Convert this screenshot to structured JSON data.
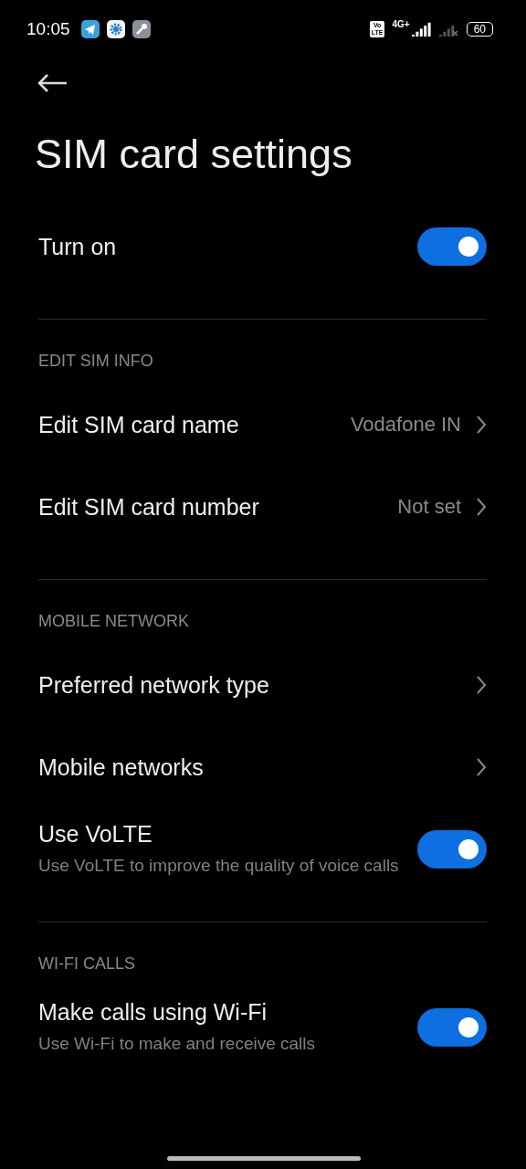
{
  "status_bar": {
    "time": "10:05",
    "volte_badge": [
      "Vo",
      "LTE"
    ],
    "network_type": "4G+",
    "battery": "60"
  },
  "title": "SIM card settings",
  "sections": [
    {
      "items": [
        {
          "kind": "toggle",
          "label": "Turn on",
          "on": true
        }
      ]
    },
    {
      "header": "EDIT SIM INFO",
      "items": [
        {
          "kind": "link",
          "label": "Edit SIM card name",
          "value": "Vodafone IN"
        },
        {
          "kind": "link",
          "label": "Edit SIM card number",
          "value": "Not set"
        }
      ]
    },
    {
      "header": "MOBILE NETWORK",
      "items": [
        {
          "kind": "link",
          "label": "Preferred network type"
        },
        {
          "kind": "link",
          "label": "Mobile networks"
        },
        {
          "kind": "toggle",
          "label": "Use VoLTE",
          "subtitle": "Use VoLTE to improve the quality of voice calls",
          "on": true
        }
      ]
    },
    {
      "header": "WI-FI CALLS",
      "items": [
        {
          "kind": "toggle",
          "label": "Make calls using Wi-Fi",
          "subtitle": "Use Wi-Fi to make and receive calls",
          "on": true
        }
      ]
    }
  ]
}
